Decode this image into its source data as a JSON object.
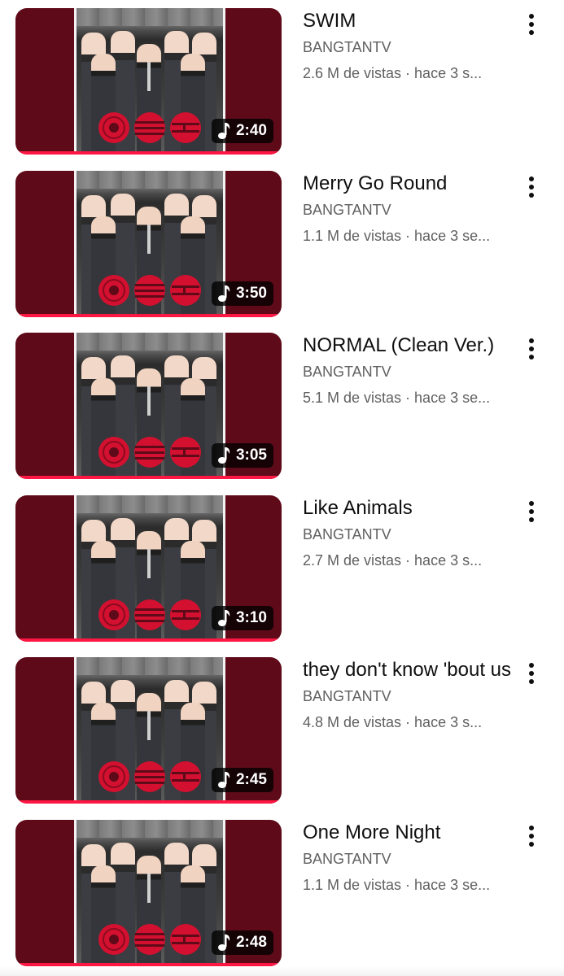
{
  "videos": [
    {
      "title": "SWIM",
      "channel": "BANGTANTV",
      "meta": "2.6 M de vistas · hace 3 s...",
      "duration": "2:40"
    },
    {
      "title": "Merry Go Round",
      "channel": "BANGTANTV",
      "meta": "1.1 M de vistas · hace 3 se...",
      "duration": "3:50"
    },
    {
      "title": "NORMAL (Clean Ver.)",
      "channel": "BANGTANTV",
      "meta": "5.1 M de vistas · hace 3 se...",
      "duration": "3:05"
    },
    {
      "title": "Like Animals",
      "channel": "BANGTANTV",
      "meta": "2.7 M de vistas · hace 3 s...",
      "duration": "3:10"
    },
    {
      "title": "they don't know 'bout us",
      "channel": "BANGTANTV",
      "meta": "4.8 M de vistas · hace 3 s...",
      "duration": "2:45"
    },
    {
      "title": "One More Night",
      "channel": "BANGTANTV",
      "meta": "1.1 M de vistas · hace 3 se...",
      "duration": "2:48"
    }
  ],
  "colors": {
    "thumb_bg": "#5e0a19",
    "progress": "#ff1744",
    "logo_red": "#d3102f"
  },
  "icons": {
    "duration": "music-note-icon",
    "menu": "more-vertical-icon"
  }
}
